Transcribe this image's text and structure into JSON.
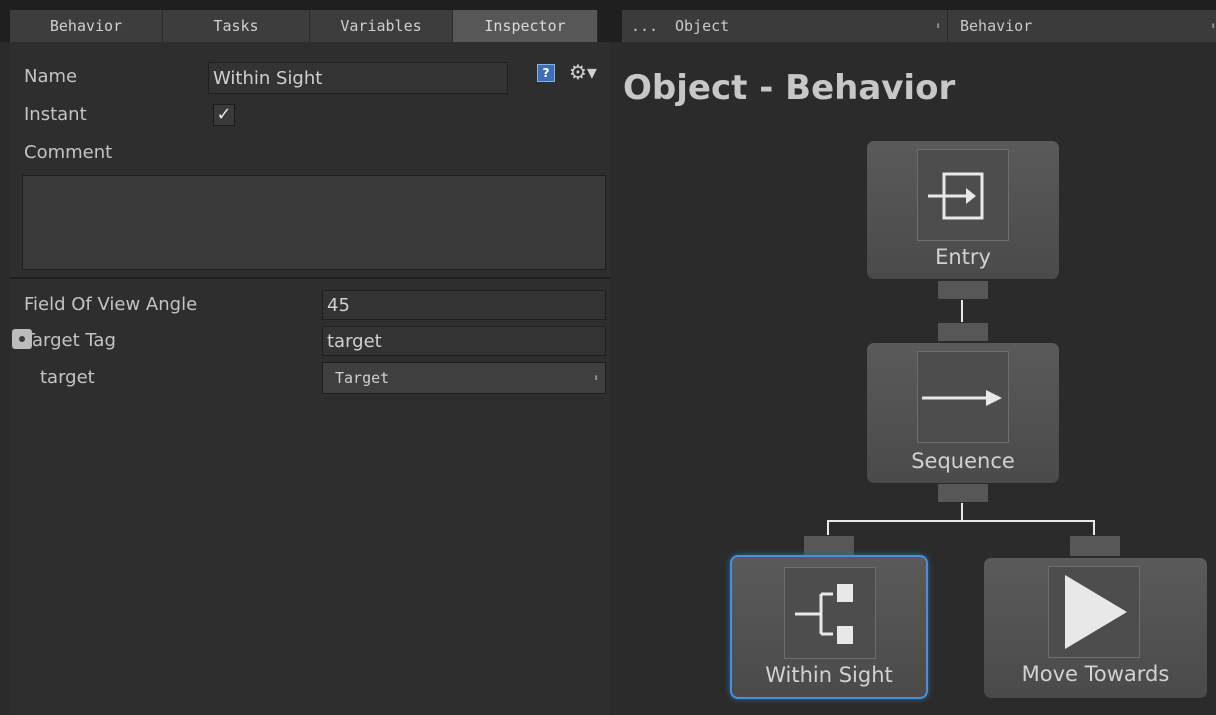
{
  "tabs": [
    {
      "label": "Behavior"
    },
    {
      "label": "Tasks"
    },
    {
      "label": "Variables"
    },
    {
      "label": "Inspector"
    }
  ],
  "graph_toolbar": {
    "more": "...",
    "object": "Object",
    "behavior": "Behavior"
  },
  "inspector": {
    "name_label": "Name",
    "name_value": "Within Sight",
    "instant_label": "Instant",
    "instant_checked": true,
    "instant_check_glyph": "✓",
    "help_glyph": "?",
    "comment_label": "Comment",
    "comment_value": "",
    "fields": {
      "fov_label": "Field Of View Angle",
      "fov_value": "45",
      "tag_label": "Target Tag",
      "tag_value": "target",
      "target_label": "target",
      "target_value": "Target"
    }
  },
  "graph": {
    "title": "Object - Behavior",
    "nodes": [
      {
        "label": "Entry",
        "icon": "entry-icon"
      },
      {
        "label": "Sequence",
        "icon": "arrow-right-icon"
      },
      {
        "label": "Within Sight",
        "icon": "conditional-icon",
        "selected": true
      },
      {
        "label": "Move Towards",
        "icon": "play-icon"
      }
    ]
  },
  "colors": {
    "selection_blue": "#4a90d9",
    "background": "#2b2b2b"
  }
}
